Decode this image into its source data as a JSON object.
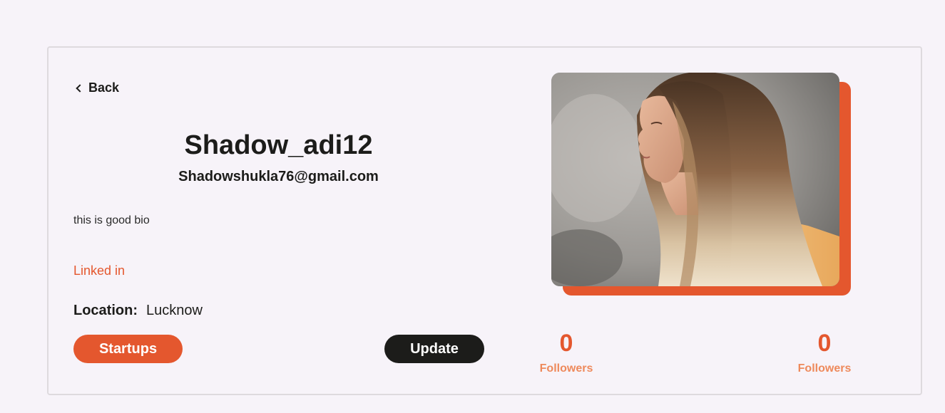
{
  "back_label": "Back",
  "profile": {
    "username": "Shadow_adi12",
    "email": "Shadowshukla76@gmail.com",
    "bio": "this is good bio",
    "linkedin_label": "Linked in",
    "location_label": "Location:",
    "location_value": "Lucknow"
  },
  "buttons": {
    "startups_label": "Startups",
    "update_label": "Update"
  },
  "stats": [
    {
      "value": "0",
      "label": "Followers"
    },
    {
      "value": "0",
      "label": "Followers"
    }
  ],
  "colors": {
    "accent": "#e4572e",
    "accent_light": "#ee8a5c",
    "dark": "#1c1c1a",
    "background": "#f7f3f9"
  },
  "icons": {
    "back": "chevron-left-icon"
  }
}
